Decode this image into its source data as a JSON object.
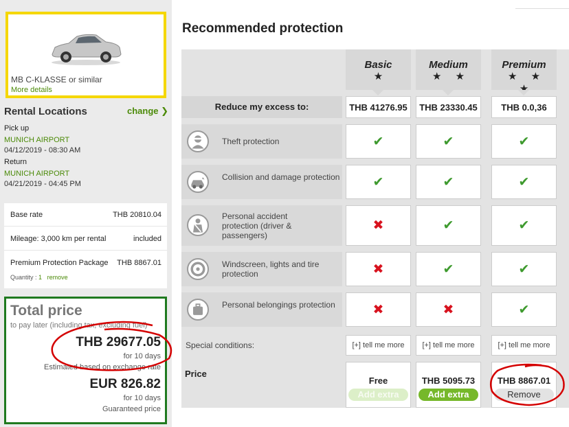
{
  "sidebar": {
    "car": {
      "name": "MB C-KLASSE or similar",
      "more_details": "More details"
    },
    "rental_locations": {
      "title": "Rental Locations",
      "change": "change",
      "change_icon": "chevron-right-icon",
      "pickup_label": "Pick up",
      "pickup_location": "MUNICH AIRPORT",
      "pickup_datetime": "04/12/2019 - 08:30 AM",
      "return_label": "Return",
      "return_location": "MUNICH AIRPORT",
      "return_datetime": "04/21/2019 - 04:45 PM"
    },
    "rates": {
      "base_rate_label": "Base rate",
      "base_rate_value": "THB 20810.04",
      "mileage_label": "Mileage: 3,000 km per rental",
      "mileage_value": "included",
      "package_label": "Premium Protection Package",
      "package_value": "THB 8867.01",
      "quantity_label": "Quantity :",
      "quantity_value": "1",
      "remove": "remove"
    },
    "total": {
      "title": "Total price",
      "subtitle": "to pay later (including tax, excluding fuel)",
      "amount": "THB 29677.05",
      "duration": "for 10 days",
      "estimate_note": "Estimated based on exchange rate",
      "eur_amount": "EUR 826.82",
      "eur_duration": "for 10 days",
      "guaranteed": "Guaranteed price"
    }
  },
  "main": {
    "title": "Recommended protection",
    "plans": [
      {
        "name": "Basic",
        "stars": "★",
        "excess": "THB 41276.95",
        "price": "Free",
        "button": "Add extra"
      },
      {
        "name": "Medium",
        "stars": "★ ★",
        "excess": "THB 23330.45",
        "price": "THB 5095.73",
        "button": "Add extra"
      },
      {
        "name": "Premium",
        "stars": "★ ★ ★",
        "excess": "THB 0.0,36",
        "price": "THB 8867.01",
        "button": "Remove"
      }
    ],
    "excess_label": "Reduce my excess to:",
    "rows": [
      {
        "label": "Theft protection",
        "icon": "thief-icon",
        "marks": [
          "check",
          "check",
          "check"
        ]
      },
      {
        "label": "Collision and damage protection",
        "icon": "collision-car-icon",
        "marks": [
          "check",
          "check",
          "check"
        ]
      },
      {
        "label": "Personal accident protection (driver & passengers)",
        "icon": "seatbelt-icon",
        "marks": [
          "cross",
          "check",
          "check"
        ]
      },
      {
        "label": "Windscreen, lights and tire protection",
        "icon": "tire-icon",
        "marks": [
          "cross",
          "check",
          "check"
        ]
      },
      {
        "label": "Personal belongings protection",
        "icon": "luggage-icon",
        "marks": [
          "cross",
          "cross",
          "check"
        ]
      }
    ],
    "special_conditions_label": "Special conditions:",
    "tell_me_more": "[+] tell me more",
    "price_label": "Price",
    "check_glyph": "✔",
    "cross_glyph": "✖"
  },
  "colors": {
    "accent_green": "#4b8a08",
    "check_green": "#3e9a2e",
    "cross_red": "#d8121e",
    "car_border_yellow": "#f5d700",
    "total_border_green": "#1f7a1f",
    "annotation_red": "#d40000"
  }
}
